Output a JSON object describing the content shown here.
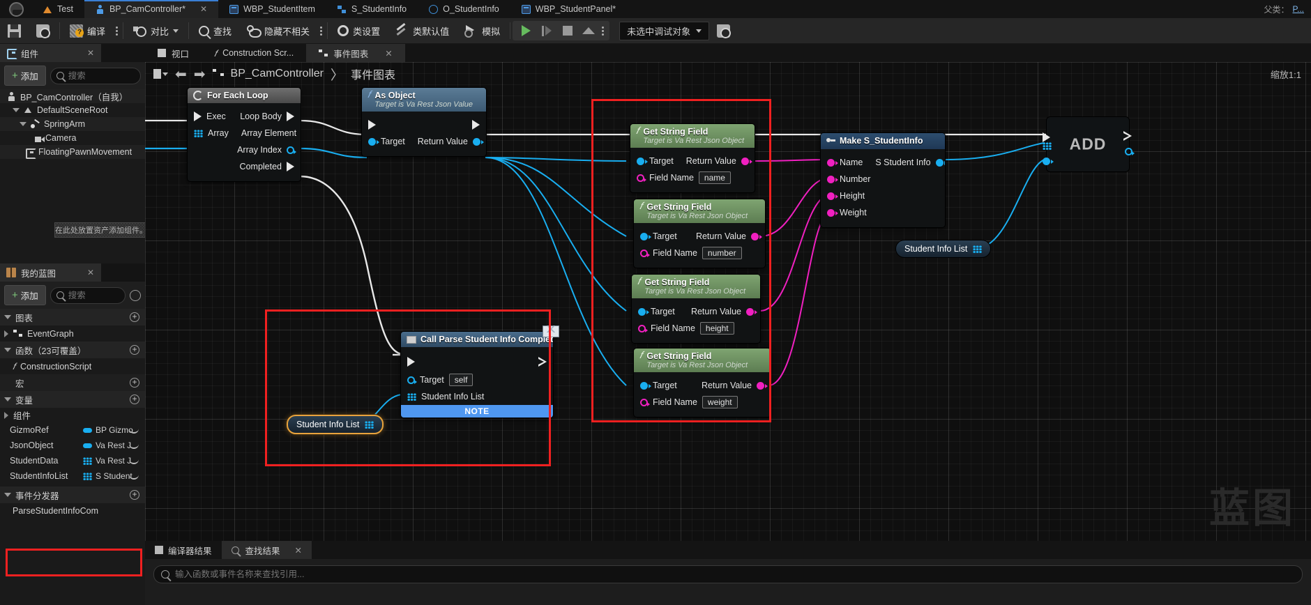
{
  "window": {
    "tabs": [
      {
        "label": "Test",
        "icon": "test-icon",
        "active": false
      },
      {
        "label": "BP_CamController*",
        "icon": "blueprint-icon",
        "active": true,
        "closable": true
      },
      {
        "label": "WBP_StudentItem",
        "icon": "widget-icon",
        "active": false
      },
      {
        "label": "S_StudentInfo",
        "icon": "struct-icon",
        "active": false
      },
      {
        "label": "O_StudentInfo",
        "icon": "object-icon",
        "active": false
      },
      {
        "label": "WBP_StudentPanel*",
        "icon": "widget-icon",
        "active": false
      }
    ],
    "parent_class_label": "父类：",
    "parent_class_value": "P..."
  },
  "toolbar": {
    "save": "保存",
    "browse": "浏览",
    "compile": "编译",
    "diff": "对比",
    "find": "查找",
    "hide_unrelated": "隐藏不相关",
    "class_settings": "类设置",
    "class_defaults": "类默认值",
    "simulate": "模拟",
    "debug_object": "未选中调试对象"
  },
  "components_panel": {
    "title": "组件",
    "add_label": "添加",
    "search_placeholder": "搜索",
    "drop_hint": "在此处放置资产添加组件。",
    "tree": [
      {
        "label": "BP_CamController（自我）",
        "icon": "pawn-icon",
        "depth": 0
      },
      {
        "label": "DefaultSceneRoot",
        "icon": "scene-root-icon",
        "depth": 1
      },
      {
        "label": "SpringArm",
        "icon": "spring-arm-icon",
        "depth": 2
      },
      {
        "label": "Camera",
        "icon": "camera-icon",
        "depth": 3
      },
      {
        "label": "FloatingPawnMovement",
        "icon": "movement-icon",
        "depth": 2
      }
    ]
  },
  "myblueprint_panel": {
    "title": "我的蓝图",
    "add_label": "添加",
    "search_placeholder": "搜索",
    "sections": {
      "graphs": "图表",
      "functions": "函数（23可覆盖）",
      "macros": "宏",
      "variables": "变量",
      "components": "组件",
      "event_dispatchers": "事件分发器"
    },
    "graph_items": [
      {
        "label": "EventGraph",
        "icon": "graph-icon"
      }
    ],
    "function_items": [
      {
        "label": "ConstructionScript",
        "icon": "function-icon"
      }
    ],
    "variables": [
      {
        "name": "GizmoRef",
        "type": "BP Gizmo",
        "pin": "object",
        "highlighted": false
      },
      {
        "name": "JsonObject",
        "type": "Va Rest J",
        "pin": "object",
        "highlighted": false
      },
      {
        "name": "StudentData",
        "type": "Va Rest J",
        "pin": "array",
        "highlighted": false
      },
      {
        "name": "StudentInfoList",
        "type": "S Student",
        "pin": "array",
        "highlighted": true
      }
    ],
    "dispatchers": [
      {
        "name": "ParseStudentInfoCom"
      }
    ]
  },
  "graph_tabs": [
    {
      "label": "视口",
      "icon": "viewport-icon",
      "active": false
    },
    {
      "label": "Construction Scr...",
      "icon": "function-icon",
      "active": false
    },
    {
      "label": "事件图表",
      "icon": "graph-icon",
      "active": true,
      "closable": true
    }
  ],
  "breadcrumb": {
    "root": "BP_CamController",
    "separator": "〉",
    "current": "事件图表"
  },
  "zoom": "缩放1:1",
  "watermark": "蓝图",
  "nodes": {
    "for_each_loop": {
      "title": "For Each Loop",
      "inputs": [
        {
          "label": "Exec",
          "pin": "exec"
        },
        {
          "label": "Array",
          "pin": "array"
        }
      ],
      "outputs": [
        {
          "label": "Loop Body",
          "pin": "exec"
        },
        {
          "label": "Array Element",
          "pin": "object"
        },
        {
          "label": "Array Index",
          "pin": "int"
        },
        {
          "label": "Completed",
          "pin": "exec"
        }
      ]
    },
    "as_object": {
      "title": "As Object",
      "subtitle": "Target is Va Rest Json Value",
      "inputs": [
        {
          "label": "",
          "pin": "exec"
        },
        {
          "label": "Target",
          "pin": "object"
        }
      ],
      "outputs": [
        {
          "label": "",
          "pin": "exec"
        },
        {
          "label": "Return Value",
          "pin": "object"
        }
      ]
    },
    "get_string_fields": [
      {
        "title": "Get String Field",
        "subtitle": "Target is Va Rest Json Object",
        "target": "Target",
        "return": "Return Value",
        "field_label": "Field Name",
        "field_value": "name"
      },
      {
        "title": "Get String Field",
        "subtitle": "Target is Va Rest Json Object",
        "target": "Target",
        "return": "Return Value",
        "field_label": "Field Name",
        "field_value": "number"
      },
      {
        "title": "Get String Field",
        "subtitle": "Target is Va Rest Json Object",
        "target": "Target",
        "return": "Return Value",
        "field_label": "Field Name",
        "field_value": "height"
      },
      {
        "title": "Get String Field",
        "subtitle": "Target is Va Rest Json Object",
        "target": "Target",
        "return": "Return Value",
        "field_label": "Field Name",
        "field_value": "weight"
      }
    ],
    "make_struct": {
      "title": "Make S_StudentInfo",
      "inputs": [
        {
          "label": "Name",
          "pin": "string"
        },
        {
          "label": "Number",
          "pin": "string"
        },
        {
          "label": "Height",
          "pin": "string"
        },
        {
          "label": "Weight",
          "pin": "string"
        }
      ],
      "outputs": [
        {
          "label": "S Student Info",
          "pin": "struct"
        }
      ]
    },
    "add_node": {
      "label": "ADD"
    },
    "student_info_list_get_right": {
      "label": "Student Info List"
    },
    "student_info_list_get_left": {
      "label": "Student Info List",
      "selected": true
    },
    "call_dispatcher": {
      "title": "Call Parse Student Info Completed",
      "inputs": [
        {
          "label": "Target",
          "pin": "object",
          "value": "self"
        },
        {
          "label": "Student Info List",
          "pin": "array"
        }
      ],
      "note": "NOTE"
    }
  },
  "bottom": {
    "tabs": [
      {
        "label": "编译器结果",
        "icon": "compiler-icon",
        "active": false
      },
      {
        "label": "查找结果",
        "icon": "search-icon",
        "active": true,
        "closable": true
      }
    ],
    "search_placeholder": "输入函数或事件名称来查找引用..."
  },
  "colors": {
    "exec_white": "#e8e8e8",
    "object_blue": "#19aef0",
    "string_magenta": "#f020c0",
    "highlight_red": "#f02020",
    "selected_orange": "#e8a33d",
    "note_blue": "#4f97f0",
    "green_header": "#7fa471"
  }
}
